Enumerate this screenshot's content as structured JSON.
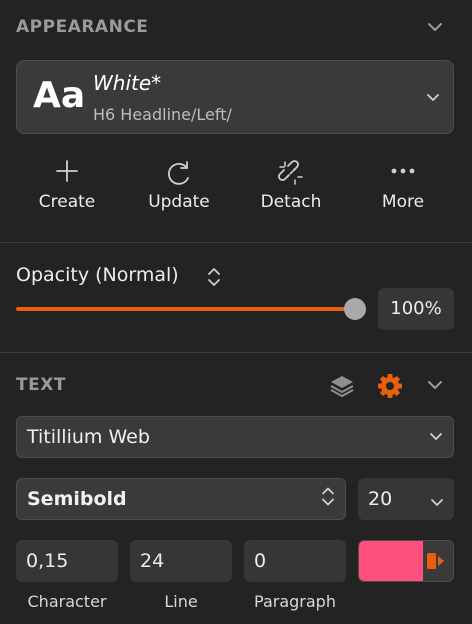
{
  "appearance": {
    "title": "APPEARANCE",
    "style": {
      "preview": "Aa",
      "name": "White*",
      "path": "H6 Headline/Left/"
    },
    "actions": [
      {
        "label": "Create",
        "icon": "plus-icon"
      },
      {
        "label": "Update",
        "icon": "refresh-icon"
      },
      {
        "label": "Detach",
        "icon": "detach-link-icon"
      },
      {
        "label": "More",
        "icon": "more-dots-icon"
      }
    ]
  },
  "opacity": {
    "label": "Opacity (Normal)",
    "value": 1.0,
    "value_text": "100%"
  },
  "text": {
    "title": "TEXT",
    "font_family": "Titillium Web",
    "font_weight": "Semibold",
    "font_size": "20",
    "character": {
      "value": "0,15",
      "caption": "Character"
    },
    "line": {
      "value": "24",
      "caption": "Line"
    },
    "paragraph": {
      "value": "0",
      "caption": "Paragraph"
    },
    "color": "#ff4f7b"
  },
  "colors": {
    "accent": "#e85f0c",
    "swatch": "#ff4f7b"
  }
}
